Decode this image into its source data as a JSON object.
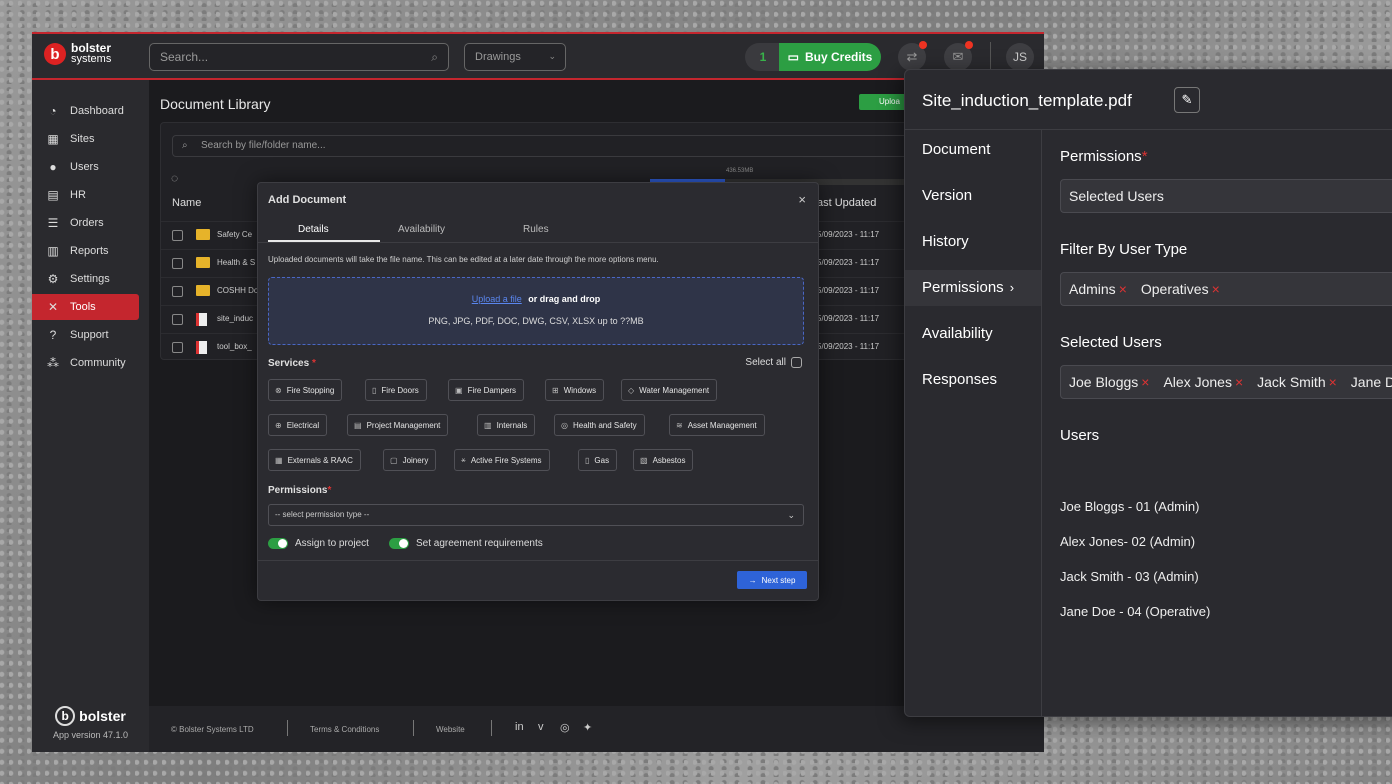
{
  "topbar": {
    "logo_name": "bolster",
    "logo_sub": "systems",
    "search_placeholder": "Search...",
    "dropdown_value": "Drawings",
    "credit_count": "1",
    "buy_credits_label": "Buy Credits",
    "avatar_initials": "JS"
  },
  "sidebar": {
    "items": [
      {
        "label": "Dashboard",
        "icon": "◔"
      },
      {
        "label": "Sites",
        "icon": "▦"
      },
      {
        "label": "Users",
        "icon": "●"
      },
      {
        "label": "HR",
        "icon": "▤"
      },
      {
        "label": "Orders",
        "icon": "☰"
      },
      {
        "label": "Reports",
        "icon": "▥"
      },
      {
        "label": "Settings",
        "icon": "⚙"
      },
      {
        "label": "Tools",
        "icon": "✕"
      },
      {
        "label": "Support",
        "icon": "?"
      },
      {
        "label": "Community",
        "icon": "⁂"
      }
    ],
    "app_version": "App version 47.1.0"
  },
  "library": {
    "title": "Document Library",
    "upload_label": "Uploa",
    "search_placeholder": "Search by file/folder name...",
    "usage_label": "436.53MB",
    "col_name": "Name",
    "col_updated": "ast Updated",
    "rows": [
      {
        "name": "Safety Ce",
        "date": "5/09/2023 - 11:17",
        "type": "folder"
      },
      {
        "name": "Health & S",
        "date": "5/09/2023 - 11:17",
        "type": "folder"
      },
      {
        "name": "COSHH Do",
        "date": "5/09/2023 - 11:17",
        "type": "folder"
      },
      {
        "name": "site_induc",
        "date": "5/09/2023 - 11:17",
        "type": "pdf"
      },
      {
        "name": "tool_box_",
        "date": "5/09/2023 - 11:17",
        "type": "pdf"
      }
    ]
  },
  "footer": {
    "copyright": "© Bolster Systems LTD",
    "terms": "Terms & Conditions",
    "website": "Website"
  },
  "modal": {
    "title": "Add Document",
    "tabs": [
      "Details",
      "Availability",
      "Rules"
    ],
    "note": "Uploaded documents will take the file name. This can be edited at a later date through the more options menu.",
    "upload_link": "Upload a file",
    "drag_text": "or drag and drop",
    "formats": "PNG, JPG, PDF, DOC, DWG, CSV, XLSX up to ??MB",
    "services_label": "Services",
    "select_all": "Select all",
    "services": [
      "Fire Stopping",
      "Fire Doors",
      "Fire Dampers",
      "Windows",
      "Water Management",
      "Electrical",
      "Project Management",
      "Internals",
      "Health and Safety",
      "Asset Management",
      "Externals & RAAC",
      "Joinery",
      "Active Fire Systems",
      "Gas",
      "Asbestos"
    ],
    "permissions_label": "Permissions",
    "permission_placeholder": "-- select permission type --",
    "assign_label": "Assign to project",
    "agreement_label": "Set agreement requirements",
    "next_label": "Next step"
  },
  "panel": {
    "file_name": "Site_induction_template.pdf",
    "nav": [
      "Document",
      "Version",
      "History",
      "Permissions",
      "Availability",
      "Responses"
    ],
    "permissions_label": "Permissions",
    "permissions_value": "Selected Users",
    "filter_label": "Filter By User Type",
    "filter_tags": [
      "Admins",
      "Operatives"
    ],
    "selected_label": "Selected Users",
    "selected_tags": [
      "Joe Bloggs",
      "Alex Jones",
      "Jack Smith",
      "Jane Do"
    ],
    "users_label": "Users",
    "users": [
      "Joe Bloggs - 01 (Admin)",
      "Alex Jones- 02 (Admin)",
      "Jack Smith - 03 (Admin)",
      "Jane Doe - 04 (Operative)"
    ]
  }
}
